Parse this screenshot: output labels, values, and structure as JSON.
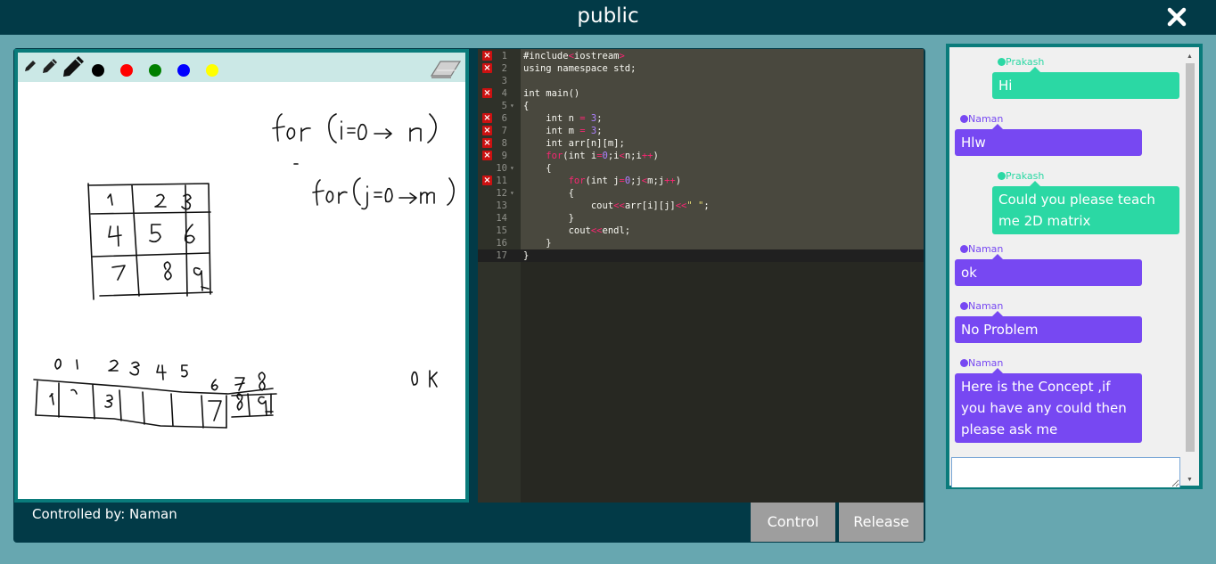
{
  "header": {
    "title": "public",
    "close_icon": "close-icon"
  },
  "whiteboard": {
    "tools": [
      "pencil-thin-icon",
      "pencil-medium-icon",
      "pencil-thick-icon"
    ],
    "colors": [
      "#000000",
      "#ff0000",
      "#008000",
      "#0000ff",
      "#ffff00"
    ],
    "eraser_icon": "eraser-icon",
    "handwriting": [
      "for (i=0 → n)",
      "for (j=0 → m)",
      "1",
      "2",
      "3",
      "4",
      "5",
      "6",
      "7",
      "8",
      "9",
      "0",
      "1",
      "2",
      "3",
      "4",
      "5",
      "6",
      "7",
      "8",
      "1",
      "2",
      "3",
      "7",
      "8",
      "9",
      "0 K"
    ]
  },
  "editor": {
    "lines": [
      {
        "n": "1",
        "err": true,
        "fold": false,
        "html": "#include<span class='kw'>&lt;</span>iostream<span class='kw'>&gt;</span>"
      },
      {
        "n": "2",
        "err": true,
        "fold": false,
        "html": "using namespace std;"
      },
      {
        "n": "3",
        "err": false,
        "fold": false,
        "html": ""
      },
      {
        "n": "4",
        "err": true,
        "fold": false,
        "html": "int main()"
      },
      {
        "n": "5",
        "err": false,
        "fold": true,
        "html": "{"
      },
      {
        "n": "6",
        "err": true,
        "fold": false,
        "html": "    int n <span class='kw'>=</span> <span class='nm'>3</span>;"
      },
      {
        "n": "7",
        "err": true,
        "fold": false,
        "html": "    int m <span class='kw'>=</span> <span class='nm'>3</span>;"
      },
      {
        "n": "8",
        "err": true,
        "fold": false,
        "html": "    int arr[n][m];"
      },
      {
        "n": "9",
        "err": true,
        "fold": false,
        "html": "    <span class='kw'>for</span>(int i<span class='kw'>=</span><span class='nm'>0</span>;i<span class='kw'>&lt;</span>n;i<span class='kw'>++</span>)"
      },
      {
        "n": "10",
        "err": false,
        "fold": true,
        "html": "    {"
      },
      {
        "n": "11",
        "err": true,
        "fold": false,
        "html": "        <span class='kw'>for</span>(int j<span class='kw'>=</span><span class='nm'>0</span>;j<span class='kw'>&lt;</span>m;j<span class='kw'>++</span>)"
      },
      {
        "n": "12",
        "err": false,
        "fold": true,
        "html": "        {"
      },
      {
        "n": "13",
        "err": false,
        "fold": false,
        "html": "            cout<span class='kw'>&lt;&lt;</span>arr[i][j]<span class='kw'>&lt;&lt;</span><span class='st'>\" \"</span>;"
      },
      {
        "n": "14",
        "err": false,
        "fold": false,
        "html": "        }"
      },
      {
        "n": "15",
        "err": false,
        "fold": false,
        "html": "        cout<span class='kw'>&lt;&lt;</span>endl;"
      },
      {
        "n": "16",
        "err": false,
        "fold": false,
        "html": "    }"
      },
      {
        "n": "17",
        "err": false,
        "fold": false,
        "html": "}"
      }
    ]
  },
  "footer": {
    "controlled_by": "Controlled by: Naman",
    "control_label": "Control",
    "release_label": "Release"
  },
  "chat": {
    "messages": [
      {
        "sender": "Prakash",
        "text": "Hi",
        "side": "right"
      },
      {
        "sender": "Naman",
        "text": "Hlw",
        "side": "left"
      },
      {
        "sender": "Prakash",
        "text": "Could you please teach me 2D matrix",
        "side": "right"
      },
      {
        "sender": "Naman",
        "text": "ok",
        "side": "left"
      },
      {
        "sender": "Naman",
        "text": "No Problem",
        "side": "left"
      },
      {
        "sender": "Naman",
        "text": "Here is the Concept ,if you have any could then please ask me",
        "side": "left"
      }
    ],
    "input_value": ""
  }
}
